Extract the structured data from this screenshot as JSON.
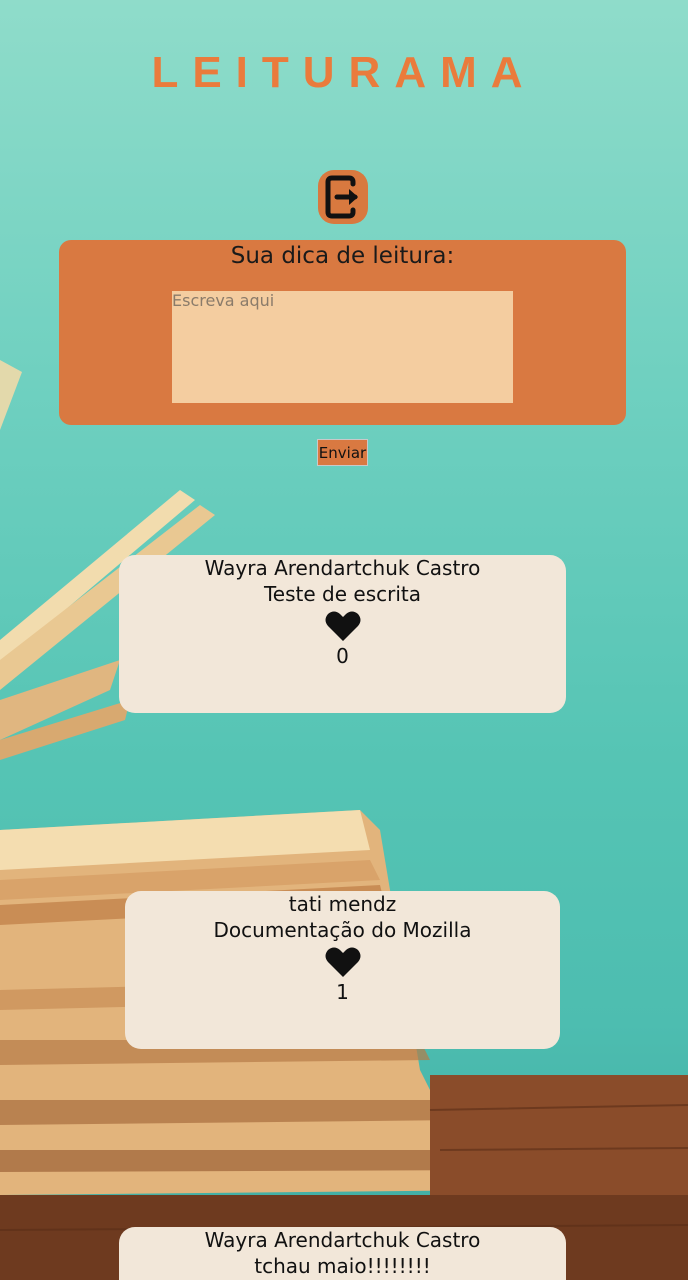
{
  "app": {
    "title": "LEITURAMA"
  },
  "logout": {
    "icon": "logout-icon"
  },
  "tip_form": {
    "heading": "Sua dica de leitura:",
    "textarea_value": "",
    "textarea_placeholder": "Escreva aqui",
    "submit_label": "Enviar"
  },
  "posts": [
    {
      "author": "Wayra Arendartchuk Castro",
      "text": "Teste de escrita",
      "likes": "0",
      "icon": "heart-icon"
    },
    {
      "author": "tati mendz",
      "text": "Documentação do Mozilla",
      "likes": "1",
      "icon": "heart-icon"
    },
    {
      "author": "Wayra Arendartchuk Castro",
      "text": "tchau maio!!!!!!!!",
      "likes": "",
      "icon": "heart-icon"
    }
  ],
  "colors": {
    "title": "#ea7b3c",
    "panel": "#d97941",
    "textarea": "#f4cda0",
    "card": "#f2e7d9",
    "background": "#6fd0c0"
  }
}
